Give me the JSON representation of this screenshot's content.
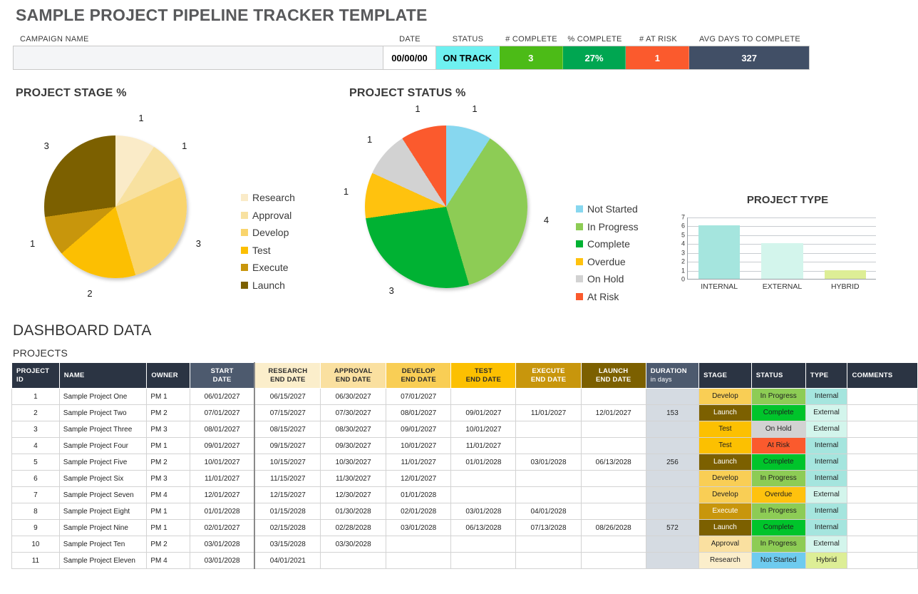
{
  "header": {
    "title": "SAMPLE PROJECT PIPELINE TRACKER TEMPLATE",
    "labels": {
      "campaign": "CAMPAIGN NAME",
      "date": "DATE",
      "status": "STATUS",
      "num_complete": "# COMPLETE",
      "pct_complete": "% COMPLETE",
      "num_at_risk": "# AT RISK",
      "avg_days": "AVG DAYS TO COMPLETE"
    },
    "values": {
      "campaign": "",
      "campaign_placeholder": "",
      "date": "00/00/00",
      "status": "ON TRACK",
      "num_complete": "3",
      "pct_complete": "27%",
      "num_at_risk": "1",
      "avg_days": "327"
    },
    "colors": {
      "status": "#6EF0F0",
      "num_complete": "#4CBB17",
      "pct_complete": "#00A651",
      "num_at_risk": "#FB5A2D",
      "avg_days": "#414F66"
    }
  },
  "chart_data": [
    {
      "type": "pie",
      "title": "PROJECT STAGE %",
      "categories": [
        "Research",
        "Approval",
        "Develop",
        "Test",
        "Execute",
        "Launch"
      ],
      "values": [
        1,
        1,
        3,
        2,
        1,
        3
      ],
      "total": 11,
      "colors": [
        "#FAEBC8",
        "#F8E1A0",
        "#F9D46C",
        "#FCBF02",
        "#C8960C",
        "#7C6000"
      ],
      "legend_position": "right",
      "labels_shown": [
        "1",
        "1",
        "3",
        "2",
        "1",
        "3"
      ]
    },
    {
      "type": "pie",
      "title": "PROJECT STATUS %",
      "categories": [
        "Not Started",
        "In Progress",
        "Complete",
        "Overdue",
        "On Hold",
        "At Risk"
      ],
      "values": [
        1,
        4,
        3,
        1,
        1,
        1
      ],
      "total": 11,
      "colors": [
        "#87D7EF",
        "#8DCC55",
        "#00B233",
        "#FFC20E",
        "#D2D2D2",
        "#FB5A2D"
      ],
      "legend_position": "right",
      "labels_shown": [
        "1",
        "4",
        "3",
        "1",
        "1",
        "1"
      ]
    },
    {
      "type": "bar",
      "title": "PROJECT TYPE",
      "categories": [
        "INTERNAL",
        "EXTERNAL",
        "HYBRID"
      ],
      "values": [
        6,
        4,
        1
      ],
      "colors": [
        "#A5E5DE",
        "#D3F5EC",
        "#DDEE96"
      ],
      "xlabel": "",
      "ylabel": "",
      "ylim": [
        0,
        7
      ],
      "yticks": [
        0,
        1,
        2,
        3,
        4,
        5,
        6,
        7
      ],
      "grid": true
    }
  ],
  "dashboard": {
    "section_title": "DASHBOARD DATA",
    "table_title": "PROJECTS",
    "columns": [
      "PROJECT ID",
      "NAME",
      "OWNER",
      "START DATE",
      "RESEARCH END DATE",
      "APPROVAL END DATE",
      "DEVELOP END DATE",
      "TEST END DATE",
      "EXECUTE END DATE",
      "LAUNCH END DATE",
      "DURATION",
      "STAGE",
      "STATUS",
      "TYPE",
      "COMMENTS"
    ],
    "column_headers": {
      "project_id_l1": "PROJECT",
      "project_id_l2": "ID",
      "name": "NAME",
      "owner": "OWNER",
      "start_l1": "START",
      "start_l2": "DATE",
      "research_l1": "RESEARCH",
      "research_l2": "END DATE",
      "approval_l1": "APPROVAL",
      "approval_l2": "END DATE",
      "develop_l1": "DEVELOP",
      "develop_l2": "END DATE",
      "test_l1": "TEST",
      "test_l2": "END DATE",
      "execute_l1": "EXECUTE",
      "execute_l2": "END DATE",
      "launch_l1": "LAUNCH",
      "launch_l2": "END DATE",
      "duration_l1": "DURATION",
      "duration_l2": "in days",
      "stage": "STAGE",
      "status": "STATUS",
      "type": "TYPE",
      "comments": "COMMENTS"
    },
    "header_colors": {
      "research": "#FBEECB",
      "approval": "#FAE0A0",
      "develop": "#F9CE55",
      "test": "#FCC001",
      "execute": "#C8960C",
      "launch": "#7C6000",
      "dark": "#2b3443",
      "slate": "#4d5a6e"
    },
    "stage_colors": {
      "Research": "#FBEECB",
      "Approval": "#FAE0A0",
      "Develop": "#F9CE55",
      "Test": "#FCC001",
      "Execute": "#C8960C",
      "Launch": "#7C6000"
    },
    "status_colors": {
      "Not Started": "#6ECBEF",
      "In Progress": "#8DCC55",
      "Complete": "#00C42B",
      "Overdue": "#FFC20E",
      "On Hold": "#D2D2D2",
      "At Risk": "#FB5A2D"
    },
    "type_colors": {
      "Internal": "#A5E5DE",
      "External": "#D3F5EC",
      "Hybrid": "#DDEE96"
    },
    "rows": [
      {
        "id": "1",
        "name": "Sample Project One",
        "owner": "PM 1",
        "start": "06/01/2027",
        "research": "06/15/2027",
        "approval": "06/30/2027",
        "develop": "07/01/2027",
        "test": "",
        "execute": "",
        "launch": "",
        "duration": "",
        "stage": "Develop",
        "status": "In Progress",
        "type": "Internal",
        "comments": ""
      },
      {
        "id": "2",
        "name": "Sample Project Two",
        "owner": "PM 2",
        "start": "07/01/2027",
        "research": "07/15/2027",
        "approval": "07/30/2027",
        "develop": "08/01/2027",
        "test": "09/01/2027",
        "execute": "11/01/2027",
        "launch": "12/01/2027",
        "duration": "153",
        "stage": "Launch",
        "status": "Complete",
        "type": "External",
        "comments": ""
      },
      {
        "id": "3",
        "name": "Sample Project Three",
        "owner": "PM 3",
        "start": "08/01/2027",
        "research": "08/15/2027",
        "approval": "08/30/2027",
        "develop": "09/01/2027",
        "test": "10/01/2027",
        "execute": "",
        "launch": "",
        "duration": "",
        "stage": "Test",
        "status": "On Hold",
        "type": "External",
        "comments": ""
      },
      {
        "id": "4",
        "name": "Sample Project Four",
        "owner": "PM 1",
        "start": "09/01/2027",
        "research": "09/15/2027",
        "approval": "09/30/2027",
        "develop": "10/01/2027",
        "test": "11/01/2027",
        "execute": "",
        "launch": "",
        "duration": "",
        "stage": "Test",
        "status": "At Risk",
        "type": "Internal",
        "comments": ""
      },
      {
        "id": "5",
        "name": "Sample Project Five",
        "owner": "PM 2",
        "start": "10/01/2027",
        "research": "10/15/2027",
        "approval": "10/30/2027",
        "develop": "11/01/2027",
        "test": "01/01/2028",
        "execute": "03/01/2028",
        "launch": "06/13/2028",
        "duration": "256",
        "stage": "Launch",
        "status": "Complete",
        "type": "Internal",
        "comments": ""
      },
      {
        "id": "6",
        "name": "Sample Project Six",
        "owner": "PM 3",
        "start": "11/01/2027",
        "research": "11/15/2027",
        "approval": "11/30/2027",
        "develop": "12/01/2027",
        "test": "",
        "execute": "",
        "launch": "",
        "duration": "",
        "stage": "Develop",
        "status": "In Progress",
        "type": "Internal",
        "comments": ""
      },
      {
        "id": "7",
        "name": "Sample Project Seven",
        "owner": "PM 4",
        "start": "12/01/2027",
        "research": "12/15/2027",
        "approval": "12/30/2027",
        "develop": "01/01/2028",
        "test": "",
        "execute": "",
        "launch": "",
        "duration": "",
        "stage": "Develop",
        "status": "Overdue",
        "type": "External",
        "comments": ""
      },
      {
        "id": "8",
        "name": "Sample Project Eight",
        "owner": "PM 1",
        "start": "01/01/2028",
        "research": "01/15/2028",
        "approval": "01/30/2028",
        "develop": "02/01/2028",
        "test": "03/01/2028",
        "execute": "04/01/2028",
        "launch": "",
        "duration": "",
        "stage": "Execute",
        "status": "In Progress",
        "type": "Internal",
        "comments": ""
      },
      {
        "id": "9",
        "name": "Sample Project Nine",
        "owner": "PM 1",
        "start": "02/01/2027",
        "research": "02/15/2028",
        "approval": "02/28/2028",
        "develop": "03/01/2028",
        "test": "06/13/2028",
        "execute": "07/13/2028",
        "launch": "08/26/2028",
        "duration": "572",
        "stage": "Launch",
        "status": "Complete",
        "type": "Internal",
        "comments": ""
      },
      {
        "id": "10",
        "name": "Sample Project Ten",
        "owner": "PM 2",
        "start": "03/01/2028",
        "research": "03/15/2028",
        "approval": "03/30/2028",
        "develop": "",
        "test": "",
        "execute": "",
        "launch": "",
        "duration": "",
        "stage": "Approval",
        "status": "In Progress",
        "type": "External",
        "comments": ""
      },
      {
        "id": "11",
        "name": "Sample Project Eleven",
        "owner": "PM 4",
        "start": "03/01/2028",
        "research": "04/01/2021",
        "approval": "",
        "develop": "",
        "test": "",
        "execute": "",
        "launch": "",
        "duration": "",
        "stage": "Research",
        "status": "Not Started",
        "type": "Hybrid",
        "comments": ""
      }
    ]
  }
}
